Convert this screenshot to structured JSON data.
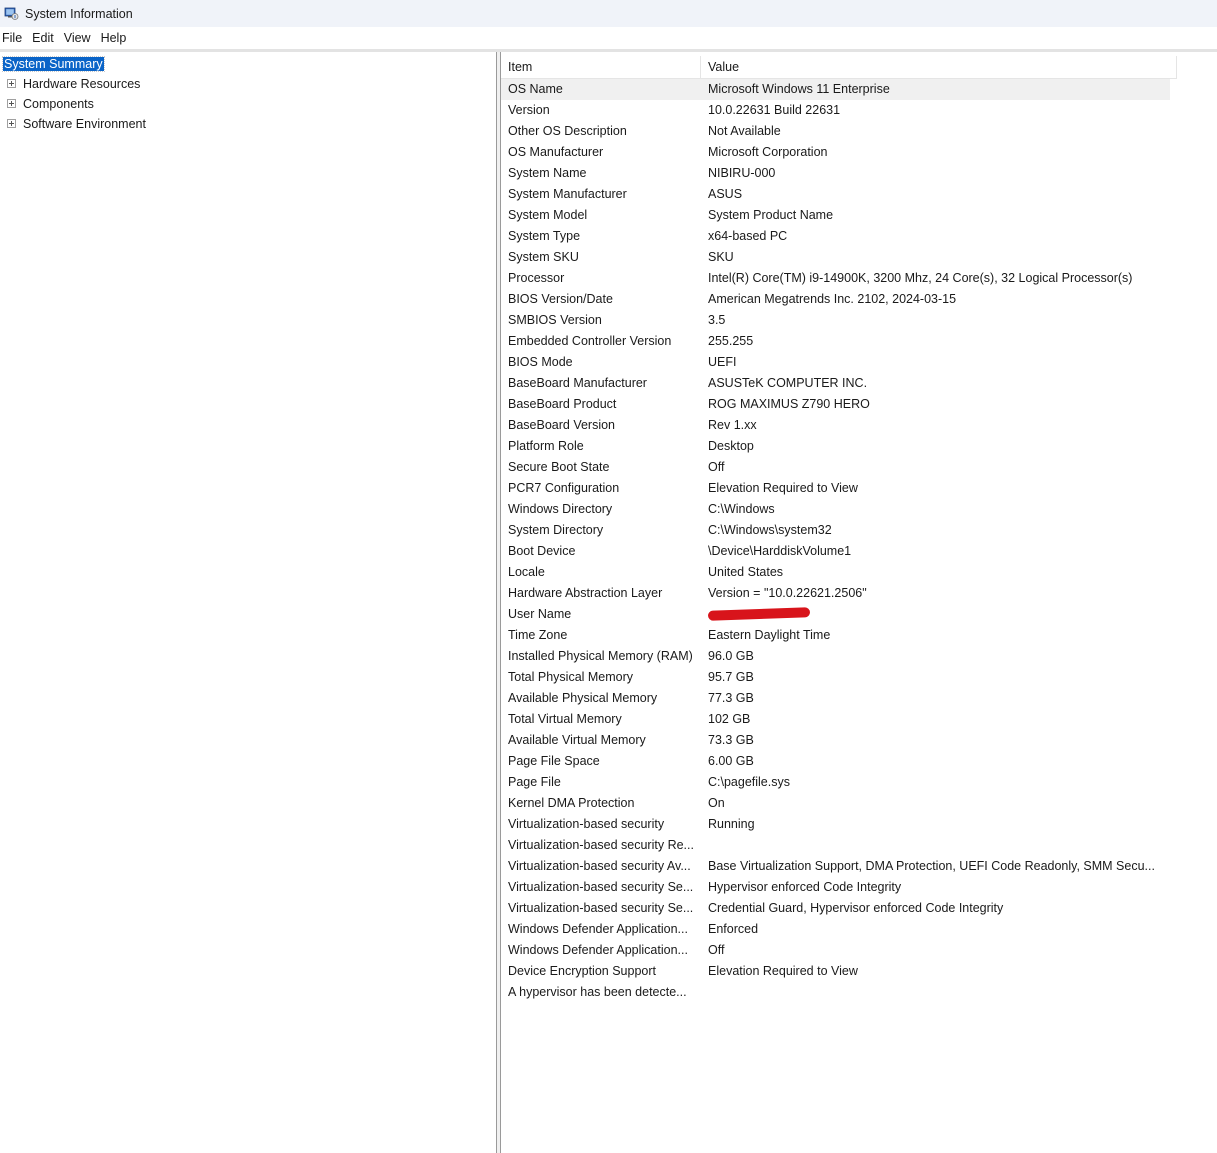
{
  "window": {
    "title": "System Information",
    "icon": "system-information-icon"
  },
  "menu": [
    "File",
    "Edit",
    "View",
    "Help"
  ],
  "tree": {
    "items": [
      {
        "label": "System Summary",
        "selected": true,
        "expandable": false
      },
      {
        "label": "Hardware Resources",
        "selected": false,
        "expandable": true
      },
      {
        "label": "Components",
        "selected": false,
        "expandable": true
      },
      {
        "label": "Software Environment",
        "selected": false,
        "expandable": true
      }
    ]
  },
  "list": {
    "columns": [
      "Item",
      "Value"
    ],
    "rows": [
      [
        "OS Name",
        "Microsoft Windows 11 Enterprise"
      ],
      [
        "Version",
        "10.0.22631 Build 22631"
      ],
      [
        "Other OS Description",
        "Not Available"
      ],
      [
        "OS Manufacturer",
        "Microsoft Corporation"
      ],
      [
        "System Name",
        "NIBIRU-000"
      ],
      [
        "System Manufacturer",
        "ASUS"
      ],
      [
        "System Model",
        "System Product Name"
      ],
      [
        "System Type",
        "x64-based PC"
      ],
      [
        "System SKU",
        "SKU"
      ],
      [
        "Processor",
        "Intel(R) Core(TM) i9-14900K, 3200 Mhz, 24 Core(s), 32 Logical Processor(s)"
      ],
      [
        "BIOS Version/Date",
        "American Megatrends Inc. 2102, 2024-03-15"
      ],
      [
        "SMBIOS Version",
        "3.5"
      ],
      [
        "Embedded Controller Version",
        "255.255"
      ],
      [
        "BIOS Mode",
        "UEFI"
      ],
      [
        "BaseBoard Manufacturer",
        "ASUSTeK COMPUTER INC."
      ],
      [
        "BaseBoard Product",
        "ROG MAXIMUS Z790 HERO"
      ],
      [
        "BaseBoard Version",
        "Rev 1.xx"
      ],
      [
        "Platform Role",
        "Desktop"
      ],
      [
        "Secure Boot State",
        "Off"
      ],
      [
        "PCR7 Configuration",
        "Elevation Required to View"
      ],
      [
        "Windows Directory",
        "C:\\Windows"
      ],
      [
        "System Directory",
        "C:\\Windows\\system32"
      ],
      [
        "Boot Device",
        "\\Device\\HarddiskVolume1"
      ],
      [
        "Locale",
        "United States"
      ],
      [
        "Hardware Abstraction Layer",
        "Version = \"10.0.22621.2506\""
      ],
      [
        "User Name",
        ""
      ],
      [
        "Time Zone",
        "Eastern Daylight Time"
      ],
      [
        "Installed Physical Memory (RAM)",
        "96.0 GB"
      ],
      [
        "Total Physical Memory",
        "95.7 GB"
      ],
      [
        "Available Physical Memory",
        "77.3 GB"
      ],
      [
        "Total Virtual Memory",
        "102 GB"
      ],
      [
        "Available Virtual Memory",
        "73.3 GB"
      ],
      [
        "Page File Space",
        "6.00 GB"
      ],
      [
        "Page File",
        "C:\\pagefile.sys"
      ],
      [
        "Kernel DMA Protection",
        "On"
      ],
      [
        "Virtualization-based security",
        "Running"
      ],
      [
        "Virtualization-based security Re...",
        ""
      ],
      [
        "Virtualization-based security Av...",
        "Base Virtualization Support, DMA Protection, UEFI Code Readonly, SMM Secu..."
      ],
      [
        "Virtualization-based security Se...",
        "Hypervisor enforced Code Integrity"
      ],
      [
        "Virtualization-based security Se...",
        "Credential Guard, Hypervisor enforced Code Integrity"
      ],
      [
        "Windows Defender Application...",
        "Enforced"
      ],
      [
        "Windows Defender Application...",
        "Off"
      ],
      [
        "Device Encryption Support",
        "Elevation Required to View"
      ],
      [
        "A hypervisor has been detecte...",
        ""
      ]
    ],
    "redacted_row": "User Name",
    "highlighted_row": "OS Name"
  },
  "colors": {
    "selection": "#0a64c8",
    "redaction": "#d8141b",
    "titlebar": "#f0f3f9"
  }
}
